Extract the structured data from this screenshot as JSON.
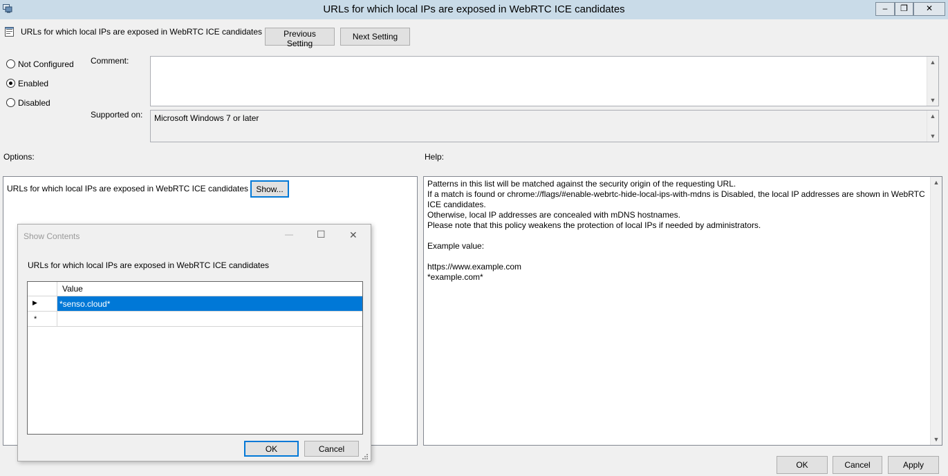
{
  "window": {
    "title": "URLs for which local IPs are exposed in WebRTC ICE candidates",
    "minimize_glyph": "–",
    "restore_glyph": "❐",
    "close_glyph": "✕"
  },
  "header": {
    "setting_name": "URLs for which local IPs are exposed in WebRTC ICE candidates",
    "prev_label": "Previous Setting",
    "next_label": "Next Setting"
  },
  "state": {
    "options": [
      {
        "label": "Not Configured",
        "selected": false
      },
      {
        "label": "Enabled",
        "selected": true
      },
      {
        "label": "Disabled",
        "selected": false
      }
    ]
  },
  "comment": {
    "label": "Comment:",
    "value": ""
  },
  "supported": {
    "label": "Supported on:",
    "value": "Microsoft Windows 7 or later"
  },
  "options_panel": {
    "label": "Options:",
    "item_label": "URLs for which local IPs are exposed in WebRTC ICE candidates",
    "show_label": "Show..."
  },
  "help_panel": {
    "label": "Help:",
    "lines": [
      "Patterns in this list will be matched against the security origin of the requesting URL.",
      "If a match is found or chrome://flags/#enable-webrtc-hide-local-ips-with-mdns is Disabled, the local IP addresses are shown in WebRTC ICE candidates.",
      "Otherwise, local IP addresses are concealed with mDNS hostnames.",
      "Please note that this policy weakens the protection of local IPs if needed by administrators.",
      "",
      "Example value:",
      "",
      "https://www.example.com",
      "*example.com*"
    ]
  },
  "footer": {
    "ok_label": "OK",
    "cancel_label": "Cancel",
    "apply_label": "Apply"
  },
  "dialog": {
    "title": "Show Contents",
    "caption": "URLs for which local IPs are exposed in WebRTC ICE candidates",
    "column_header": "Value",
    "rows": [
      {
        "marker": "▶",
        "value": "*senso.cloud*"
      },
      {
        "marker": "*",
        "value": ""
      }
    ],
    "ok_label": "OK",
    "cancel_label": "Cancel",
    "minimize_glyph": "—",
    "maximize_glyph": "☐",
    "close_glyph": "✕"
  },
  "colors": {
    "selection": "#0078d7",
    "titlebar": "#c9dbe8",
    "background": "#f0f0f0"
  }
}
